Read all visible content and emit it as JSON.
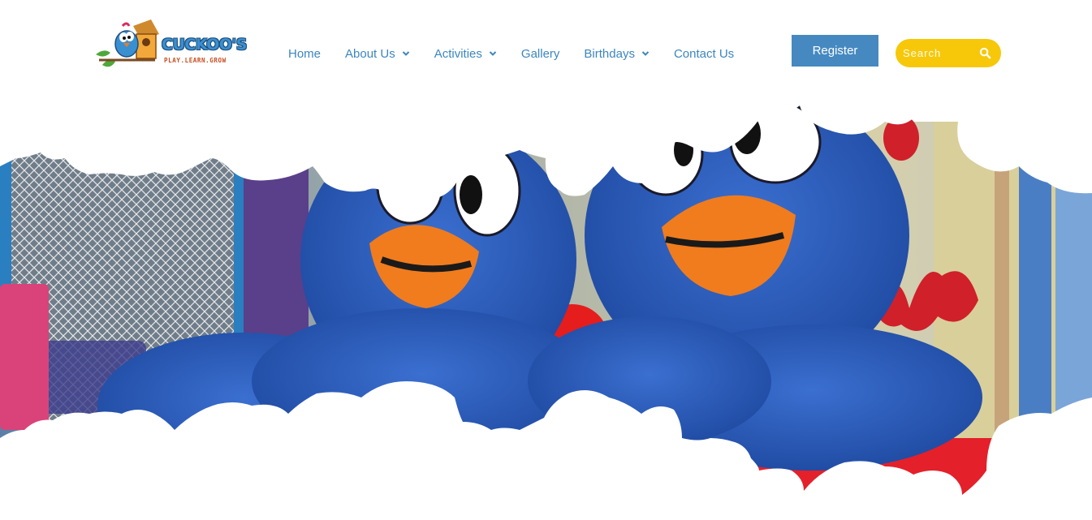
{
  "brand": {
    "name": "CUCKOO'S",
    "tagline": "PLAY.LEARN.GROW"
  },
  "nav": {
    "items": [
      {
        "label": "Home",
        "has_dropdown": false
      },
      {
        "label": "About Us",
        "has_dropdown": true
      },
      {
        "label": "Activities",
        "has_dropdown": true
      },
      {
        "label": "Gallery",
        "has_dropdown": false
      },
      {
        "label": "Birthdays",
        "has_dropdown": true
      },
      {
        "label": "Contact Us",
        "has_dropdown": false
      }
    ]
  },
  "header": {
    "register_label": "Register"
  },
  "search": {
    "placeholder": "Search",
    "icon": "search-icon"
  },
  "hero": {
    "image_alt": "Two blue bird mascot costumes in a play area"
  },
  "colors": {
    "nav_text": "#3b86bf",
    "register_bg": "#4689c0",
    "search_bg": "#f7c80a",
    "mascot_blue": "#2f5fb8",
    "beak_orange": "#f07c1e"
  }
}
